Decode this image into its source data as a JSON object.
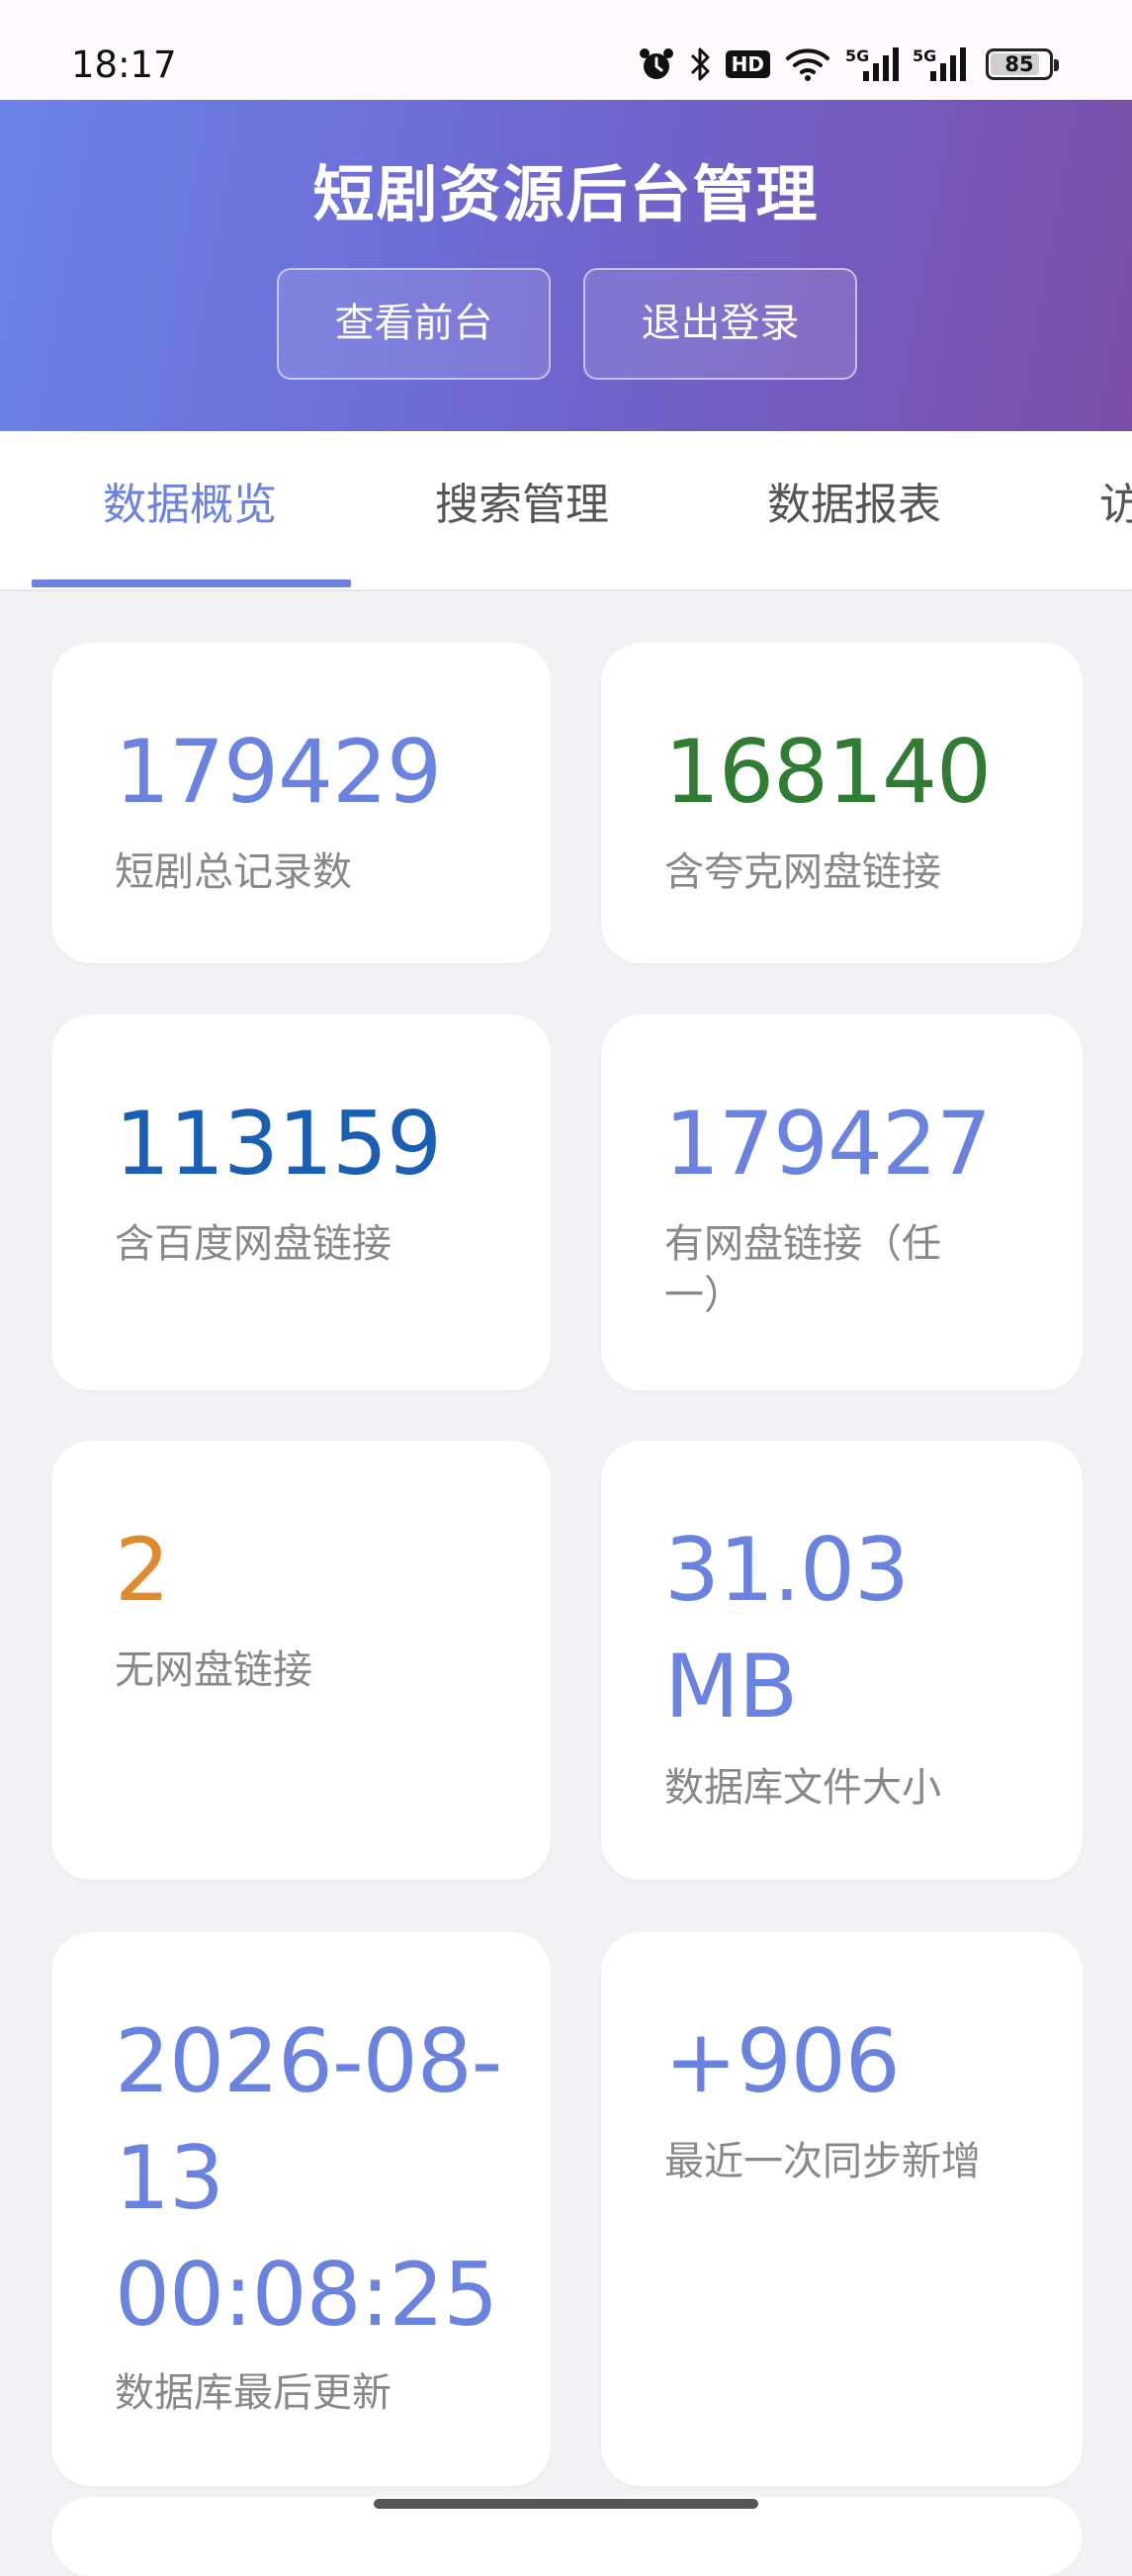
{
  "status_bar": {
    "time": "18:17",
    "icons": [
      "alarm-icon",
      "bluetooth-icon",
      "hd-icon",
      "wifi-icon",
      "signal-5g-icon",
      "signal-5g-icon",
      "battery-icon"
    ],
    "hd_label": "HD",
    "signal_label": "5G",
    "battery_level": "85"
  },
  "header": {
    "title": "短剧资源后台管理",
    "buttons": {
      "view_front": "查看前台",
      "logout": "退出登录"
    },
    "gradient": [
      "#6b83e8",
      "#7a4ea8"
    ]
  },
  "tabs": [
    {
      "label": "数据概览",
      "active": true
    },
    {
      "label": "搜索管理",
      "active": false
    },
    {
      "label": "数据报表",
      "active": false
    },
    {
      "label": "访",
      "active": false
    }
  ],
  "stats": [
    {
      "value": "179429",
      "label": "短剧总记录数",
      "color": "#6a83e1"
    },
    {
      "value": "168140",
      "label": "含夸克网盘链接",
      "color": "#2e7d32"
    },
    {
      "value": "113159",
      "label": "含百度网盘链接",
      "color": "#1a5fb4"
    },
    {
      "value": "179427",
      "label": "有网盘链接（任一）",
      "color": "#6a83e1"
    },
    {
      "value": "2",
      "label": "无网盘链接",
      "color": "#e08a2e"
    },
    {
      "value": "31.03 MB",
      "label": "数据库文件大小",
      "color": "#6a83e1"
    },
    {
      "value": "2026-08-13 00:08:25",
      "label": "数据库最后更新",
      "color": "#6a83e1"
    },
    {
      "value": "+906",
      "label": "最近一次同步新增",
      "color": "#6a83e1"
    }
  ],
  "colors": {
    "accent": "#6a83e1",
    "green": "#2e7d32",
    "blue": "#1a5fb4",
    "orange": "#e08a2e"
  }
}
